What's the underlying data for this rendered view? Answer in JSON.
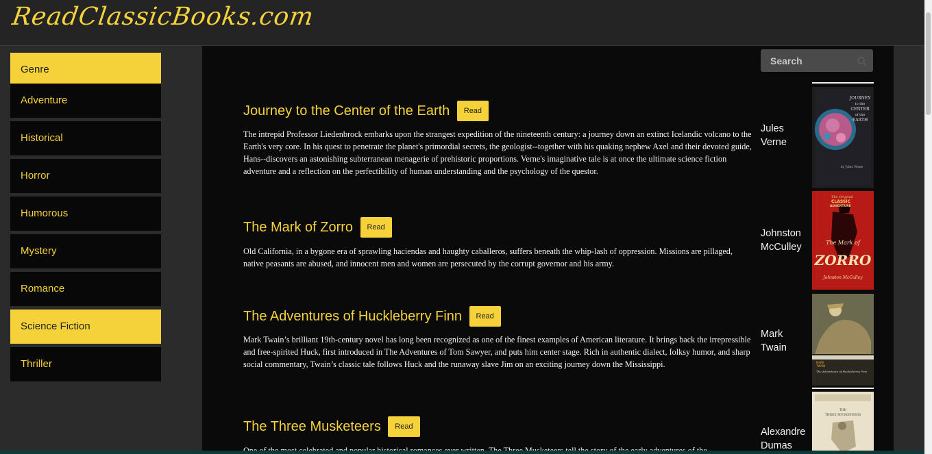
{
  "site": {
    "logo": "ReadClassicBooks.com"
  },
  "sidebar": {
    "items": [
      {
        "label": "Genre"
      },
      {
        "label": "Adventure"
      },
      {
        "label": "Historical"
      },
      {
        "label": "Horror"
      },
      {
        "label": "Humorous"
      },
      {
        "label": "Mystery"
      },
      {
        "label": "Romance"
      },
      {
        "label": "Science Fiction"
      },
      {
        "label": "Thriller"
      }
    ],
    "active": [
      "Genre",
      "Science Fiction"
    ]
  },
  "search": {
    "placeholder": "Search",
    "icon": "search-icon"
  },
  "read_label": "Read",
  "books": [
    {
      "title": "Journey to the Center of the Earth",
      "description": "The intrepid Professor Liedenbrock embarks upon the strangest expedition of the nineteenth century: a journey down an extinct Icelandic volcano to the Earth's very core. In his quest to penetrate the planet's primordial secrets, the geologist--together with his quaking nephew Axel and their devoted guide, Hans--discovers an astonishing subterranean menagerie of prehistoric proportions. Verne's imaginative tale is at once the ultimate science fiction adventure and a reflection on the perfectibility of human understanding and the psychology of the questor.",
      "author_line1": "Jules",
      "author_line2": "Verne"
    },
    {
      "title": "The Mark of Zorro",
      "description": "Old California, in a bygone era of sprawling haciendas and haughty caballeros, suffers beneath the whip-lash of oppression. Missions are pillaged, native peasants are abused, and innocent men and women are persecuted by the corrupt governor and his army.",
      "author_line1": "Johnston",
      "author_line2": "McCulley"
    },
    {
      "title": "The Adventures of Huckleberry Finn",
      "description": "Mark Twain’s brilliant 19th-century novel has long been recognized as one of the finest examples of American literature. It brings back the irrepressible and free-spirited Huck, first introduced in The Adventures of Tom Sawyer, and puts him center stage. Rich in authentic dialect, folksy humor, and sharp social commentary, Twain’s classic tale follows Huck and the runaway slave Jim on an exciting journey down the Mississippi.",
      "author_line1": "Mark",
      "author_line2": "Twain"
    },
    {
      "title": "The Three Musketeers",
      "description": "One of the most celebrated and popular historical romances ever written, The Three Musketeers tell the story of the early adventures of the",
      "author_line1": "Alexandre",
      "author_line2": "Dumas"
    }
  ],
  "covers": [
    {
      "lines": [
        "JOURNEY",
        "to the",
        "CENTER",
        "of the",
        "EARTH"
      ],
      "byline": "by Jules Verne"
    },
    {
      "top_lines": [
        "The Original",
        "CLASSIC",
        "ADVENTURE"
      ],
      "title_lines": [
        "The Mark of",
        "ZORRO"
      ],
      "byline": "Johnston McCulley"
    },
    {
      "top_lines": [
        "MARK",
        "TWAIN"
      ],
      "byline": "The Adventures of Huckleberry Finn"
    },
    {
      "title_lines": [
        "THE",
        "THREE MUSKETEERS"
      ]
    }
  ],
  "colors": {
    "accent": "#f5d23a",
    "content_bg": "#0a0a0a",
    "page_bg": "#2b2b2b"
  }
}
